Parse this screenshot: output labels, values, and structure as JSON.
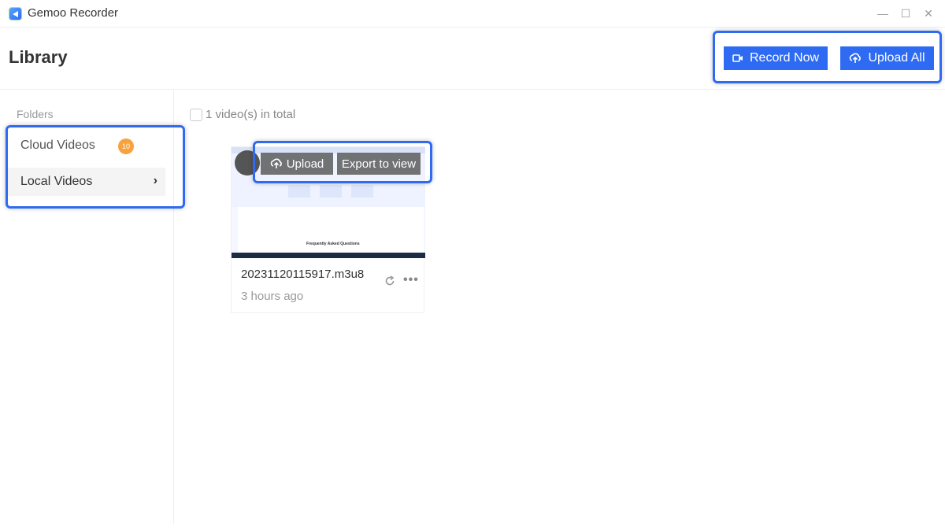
{
  "app": {
    "title": "Gemoo Recorder"
  },
  "window_controls": {
    "minimize": "—",
    "maximize": "☐",
    "close": "✕"
  },
  "header": {
    "title": "Library",
    "record_now_label": "Record Now",
    "upload_all_label": "Upload All"
  },
  "sidebar": {
    "folders_label": "Folders",
    "items": [
      {
        "label": "Cloud Videos",
        "badge": "10"
      },
      {
        "label": "Local Videos",
        "chevron": "›"
      }
    ]
  },
  "main": {
    "count_text": "1 video(s) in total",
    "videos": [
      {
        "file_name": "20231120115917.m3u8",
        "time": "3 hours ago",
        "upload_label": "Upload",
        "export_label": "Export to view",
        "thumbnail_heading": "Frequently Asked Questions",
        "more_icon": "•••"
      }
    ]
  },
  "colors": {
    "accent": "#2e6bf2",
    "badge": "#f7a23c",
    "highlight_border": "#2e6bf2"
  }
}
